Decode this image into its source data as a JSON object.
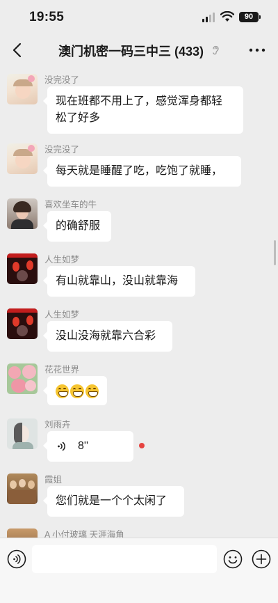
{
  "status_bar": {
    "time": "19:55",
    "battery_level": "90",
    "icons": [
      "signal-icon",
      "wifi-icon",
      "battery-icon"
    ]
  },
  "nav": {
    "title": "澳门机密一码三中三 (433)",
    "back_icon": "chevron-left-icon",
    "mute_icon": "ear-icon",
    "more_icon": "ellipsis-icon"
  },
  "messages": [
    {
      "sender": "没完没了",
      "text_lines": [
        "现在班都不用上了，感觉浑身都轻",
        "松了好多"
      ],
      "avatar": "baby-photo"
    },
    {
      "sender": "没完没了",
      "text": "每天就是睡醒了吃，吃饱了就睡，",
      "avatar": "baby-photo"
    },
    {
      "sender": "喜欢坐车的牛",
      "text": "的确舒服",
      "avatar": "woman-photo"
    },
    {
      "sender": "人生如梦",
      "text": "有山就靠山，没山就靠海",
      "avatar": "lantern-photo"
    },
    {
      "sender": "人生如梦",
      "text": "没山没海就靠六合彩",
      "avatar": "lantern-photo"
    },
    {
      "sender": "花花世界",
      "emoji": [
        "grinning-emoji",
        "grinning-emoji",
        "grinning-emoji"
      ],
      "avatar": "flowers-photo"
    },
    {
      "sender": "刘雨卉",
      "voice_duration": "8''",
      "avatar": "girl-drawing",
      "unread": true
    },
    {
      "sender": "霞姐",
      "text": "您们就是一个个太闲了",
      "avatar": "friends-photo"
    },
    {
      "sender": "A 小付玻璃 天涯海角",
      "avatar": "glass-photo"
    }
  ],
  "input_bar": {
    "placeholder": "",
    "voice_icon": "voice-input-icon",
    "emoji_icon": "smiley-icon",
    "plus_icon": "plus-circle-icon"
  },
  "colors": {
    "background": "#ededed",
    "bubble": "#ffffff",
    "sender_text": "#8a8a8a",
    "unread_dot": "#e64340"
  }
}
